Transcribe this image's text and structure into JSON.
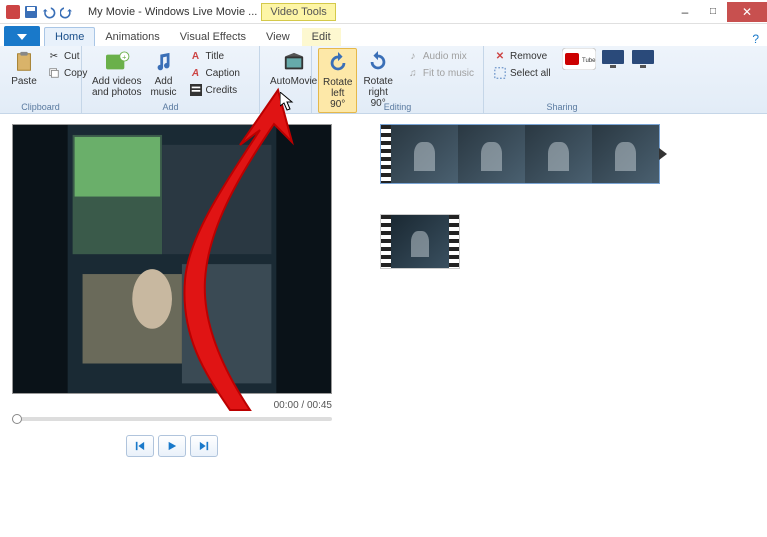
{
  "titlebar": {
    "title": "My Movie - Windows Live Movie ...",
    "video_tools_label": "Video Tools"
  },
  "window_controls": {
    "minimize": "–",
    "maximize": "□",
    "close": "✕"
  },
  "tabs": {
    "home": "Home",
    "animations": "Animations",
    "visual_effects": "Visual Effects",
    "view": "View",
    "edit": "Edit"
  },
  "ribbon": {
    "clipboard": {
      "label": "Clipboard",
      "paste": "Paste",
      "cut": "Cut",
      "copy": "Copy"
    },
    "add": {
      "label": "Add",
      "add_videos": "Add videos\nand photos",
      "add_music": "Add\nmusic",
      "title": "Title",
      "caption": "Caption",
      "credits": "Credits"
    },
    "automovie": "AutoMovie",
    "editing": {
      "label": "Editing",
      "rotate_left": "Rotate\nleft 90°",
      "rotate_right": "Rotate\nright 90°",
      "audio_mix": "Audio mix",
      "fit_to_music": "Fit to music",
      "remove": "Remove"
    },
    "sharing": {
      "label": "Sharing",
      "select_all": "Select all"
    }
  },
  "player": {
    "time": "00:00 / 00:45"
  },
  "colors": {
    "accent": "#1979ca",
    "highlight": "#fde8a8"
  }
}
